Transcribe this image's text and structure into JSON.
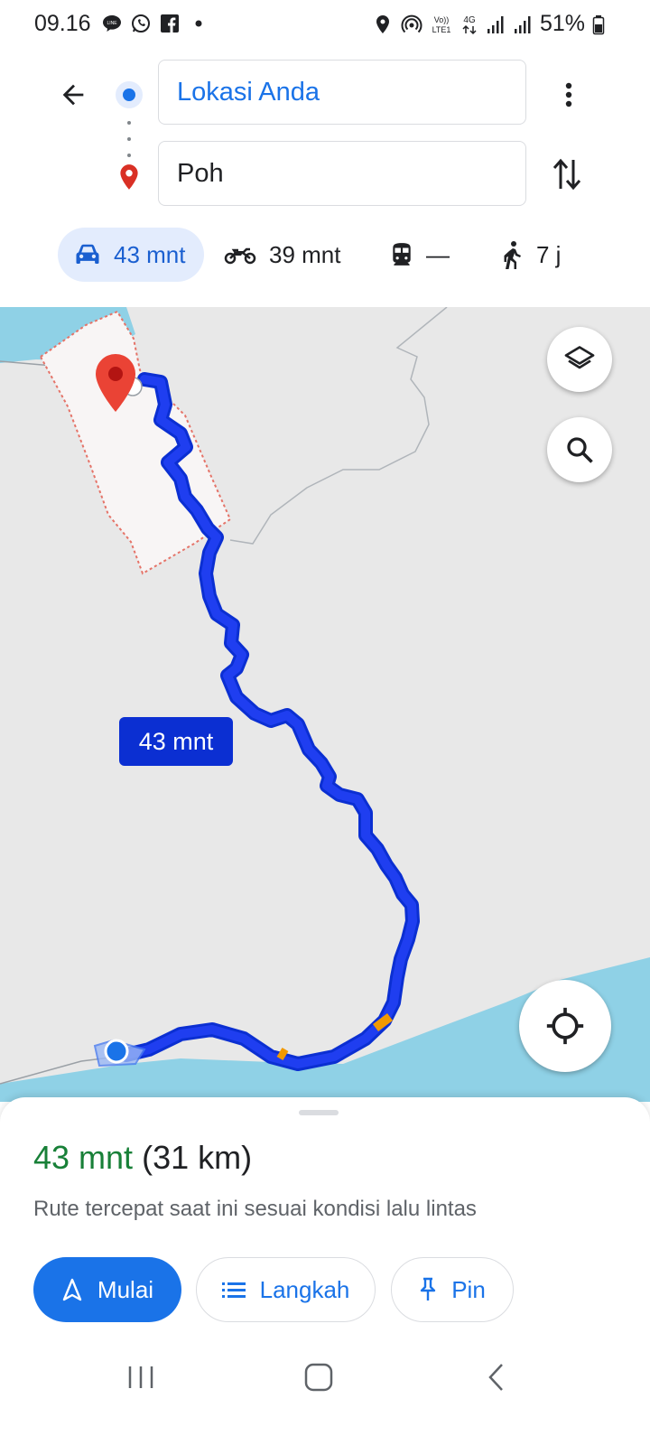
{
  "status_bar": {
    "time": "09.16",
    "battery": "51%",
    "left_icons": [
      "line-icon",
      "whatsapp-icon",
      "facebook-icon",
      "dot-icon"
    ],
    "right_icons": [
      "location-icon",
      "hotspot-icon",
      "volte-icon",
      "4g-icon",
      "signal-icon",
      "signal-icon",
      "battery-icon"
    ],
    "network_text": "Vo)) 4G LTE1"
  },
  "directions": {
    "origin": "Lokasi Anda",
    "destination": "Poh",
    "modes": [
      {
        "name": "drive",
        "label": "43 mnt",
        "active": true,
        "icon": "car-icon"
      },
      {
        "name": "motorcycle",
        "label": "39 mnt",
        "active": false,
        "icon": "motorcycle-icon"
      },
      {
        "name": "transit",
        "label": "—",
        "active": false,
        "icon": "train-icon"
      },
      {
        "name": "walk",
        "label": "7 j",
        "active": false,
        "icon": "walk-icon"
      }
    ]
  },
  "map": {
    "route_duration_label": "43 mnt",
    "colors": {
      "land": "#e8e8e8",
      "water": "#8fd1e6",
      "route": "#0b2fd2",
      "route_outline": "#1a3ee8",
      "traffic": "#f29900",
      "boundary": "#e57368",
      "pin": "#ea4335"
    }
  },
  "summary": {
    "time": "43 mnt",
    "distance": "(31 km)",
    "description": "Rute tercepat saat ini sesuai kondisi lalu lintas"
  },
  "buttons": {
    "start": "Mulai",
    "steps": "Langkah",
    "pin": "Pin"
  },
  "nav": [
    "recent-apps",
    "home",
    "back"
  ]
}
